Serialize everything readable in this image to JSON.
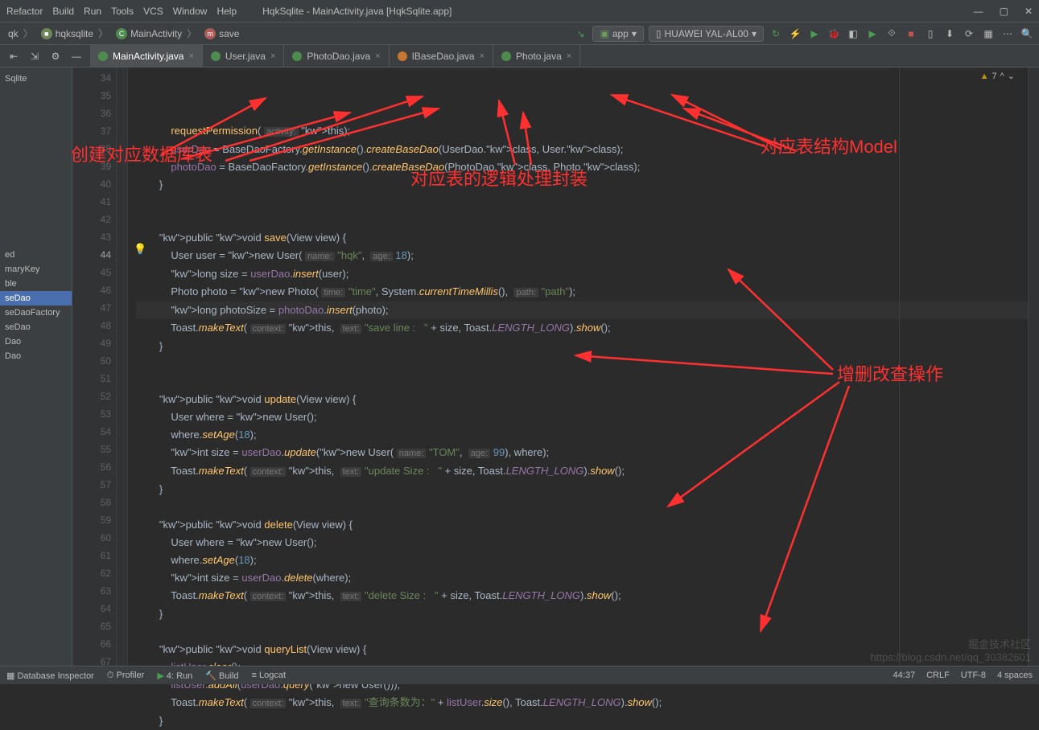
{
  "menu": {
    "refactor": "Refactor",
    "build": "Build",
    "run": "Run",
    "tools": "Tools",
    "vcs": "VCS",
    "window": "Window",
    "help": "Help"
  },
  "title": "HqkSqlite - MainActivity.java [HqkSqlite.app]",
  "win": {
    "min": "—",
    "max": "▢",
    "close": "✕"
  },
  "breadcrumbs": [
    "qk",
    "hqksqlite",
    "MainActivity",
    "save"
  ],
  "runconfig": "app",
  "device": "HUAWEI YAL-AL00",
  "warning": "7",
  "tabs": [
    {
      "label": "MainActivity.java",
      "active": true
    },
    {
      "label": "User.java",
      "active": false
    },
    {
      "label": "PhotoDao.java",
      "active": false
    },
    {
      "label": "IBaseDao.java",
      "active": false
    },
    {
      "label": "Photo.java",
      "active": false
    }
  ],
  "sidebar_head": "Sqlite",
  "sidebar_items": [
    "ed",
    "maryKey",
    "ble",
    "seDao",
    "seDaoFactory",
    "seDao",
    "Dao",
    "Dao"
  ],
  "sidebar_sel": 3,
  "line_start": 34,
  "line_end": 67,
  "current_line": 44,
  "annotations": {
    "a1": "创建对应数据库表",
    "a2": "对应表的逻辑处理封装",
    "a3": "对应表结构Model",
    "a4": "增删改查操作"
  },
  "status": {
    "dbinsp": "Database Inspector",
    "profiler": "Profiler",
    "run": "4: Run",
    "build": "Build",
    "logcat": "Logcat",
    "pos": "44:37",
    "crlf": "CRLF",
    "enc": "UTF-8",
    "indent": "4 spaces"
  },
  "watermark_l1": "掘金技术社区",
  "watermark_l2": "https://blog.csdn.net/qq_30382601",
  "code_lines": [
    "            requestPermission( activity: this);",
    "            userDao = BaseDaoFactory.getInstance().createBaseDao(UserDao.class, User.class);",
    "            photoDao = BaseDaoFactory.getInstance().createBaseDao(PhotoDao.class, Photo.class);",
    "        }",
    "",
    "",
    "        public void save(View view) {",
    "            User user = new User( name: \"hqk\",  age: 18);",
    "            long size = userDao.insert(user);",
    "            Photo photo = new Photo( time: \"time\", System.currentTimeMillis(),  path: \"path\");",
    "            long photoSize = photoDao.insert(photo);",
    "            Toast.makeText( context: this,  text: \"save line :   \" + size, Toast.LENGTH_LONG).show();",
    "        }",
    "",
    "",
    "        public void update(View view) {",
    "            User where = new User();",
    "            where.setAge(18);",
    "            int size = userDao.update(new User( name: \"TOM\",  age: 99), where);",
    "            Toast.makeText( context: this,  text: \"update Size :   \" + size, Toast.LENGTH_LONG).show();",
    "        }",
    "",
    "        public void delete(View view) {",
    "            User where = new User();",
    "            where.setAge(18);",
    "            int size = userDao.delete(where);",
    "            Toast.makeText( context: this,  text: \"delete Size :   \" + size, Toast.LENGTH_LONG).show();",
    "        }",
    "",
    "        public void queryList(View view) {",
    "            listUser.clear();",
    "            listUser.addAll(userDao.query(new User()));",
    "            Toast.makeText( context: this,  text: \"查询条数为：\" + listUser.size(), Toast.LENGTH_LONG).show();",
    "        }"
  ]
}
